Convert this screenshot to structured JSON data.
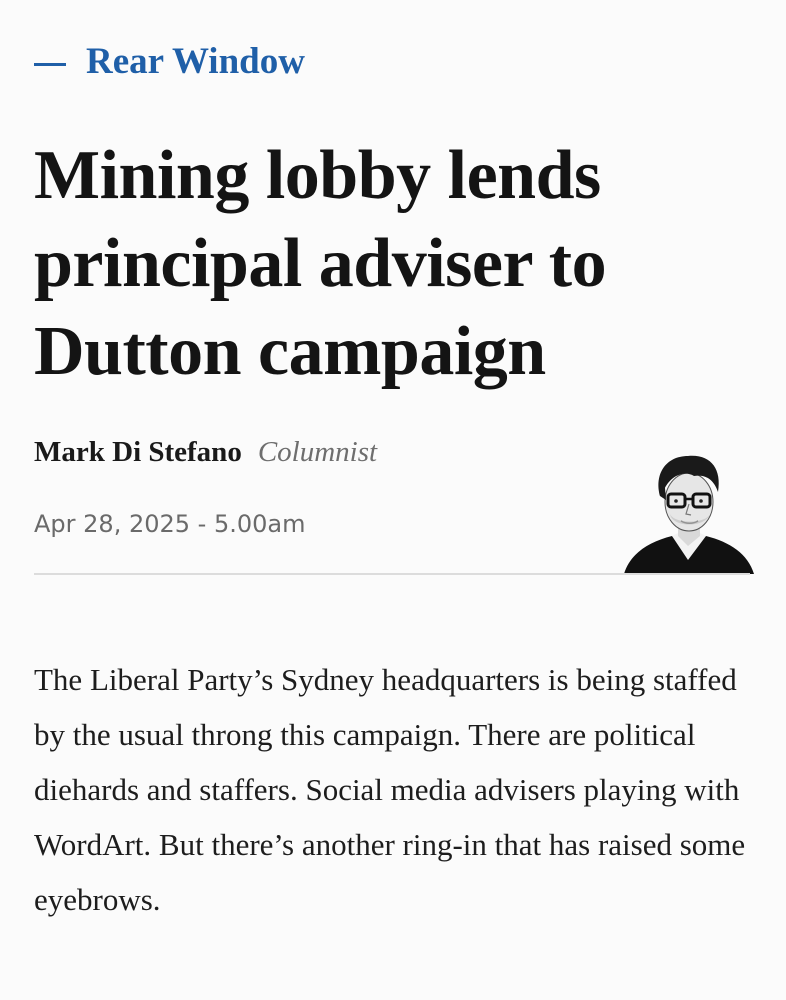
{
  "section": {
    "label": "Rear Window"
  },
  "article": {
    "headline": "Mining lobby lends principal adviser to Dutton campaign",
    "author": "Mark Di Stefano",
    "author_role": "Columnist",
    "published": "Apr 28, 2025 - 5.00am",
    "body": "The Liberal Party’s Sydney headquarters is being staffed by the usual throng this campaign. There are political diehards and staffers. Social media advisers playing with WordArt. But there’s another ring-in that has raised some eyebrows."
  },
  "colors": {
    "accent": "#1f5fa8",
    "text": "#141414",
    "muted": "#6a6a6a",
    "background": "#fbfbfb"
  }
}
